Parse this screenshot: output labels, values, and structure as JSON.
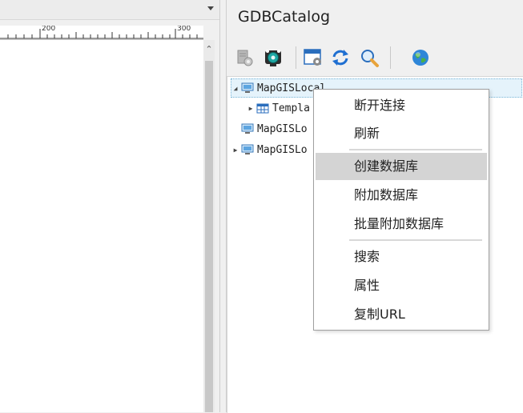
{
  "ruler": {
    "labels": [
      "200",
      "300"
    ]
  },
  "catalog": {
    "title": "GDBCatalog",
    "toolbar": [
      {
        "icon": "server-config-icon"
      },
      {
        "icon": "connect-camera-icon"
      },
      {
        "icon": "window-settings-icon"
      },
      {
        "icon": "refresh-icon"
      },
      {
        "icon": "search-icon"
      },
      {
        "icon": "globe-icon"
      }
    ],
    "tree": [
      {
        "label": "MapGISLocal",
        "expander": "◢",
        "icon": "computer-icon",
        "selected": true
      },
      {
        "label": "Templa",
        "expander": "▶",
        "icon": "table-grid-icon",
        "selected": false
      },
      {
        "label": "MapGISLo",
        "expander": "",
        "icon": "computer-icon",
        "selected": false
      },
      {
        "label": "MapGISLo",
        "expander": "▶",
        "icon": "computer-icon",
        "selected": false
      }
    ]
  },
  "context_menu": {
    "items": [
      {
        "label": "断开连接"
      },
      {
        "label": "刷新"
      },
      {
        "label": "创建数据库",
        "hover": true
      },
      {
        "label": "附加数据库"
      },
      {
        "label": "批量附加数据库"
      },
      {
        "label": "搜索"
      },
      {
        "label": "属性"
      },
      {
        "label": "复制URL"
      }
    ]
  }
}
